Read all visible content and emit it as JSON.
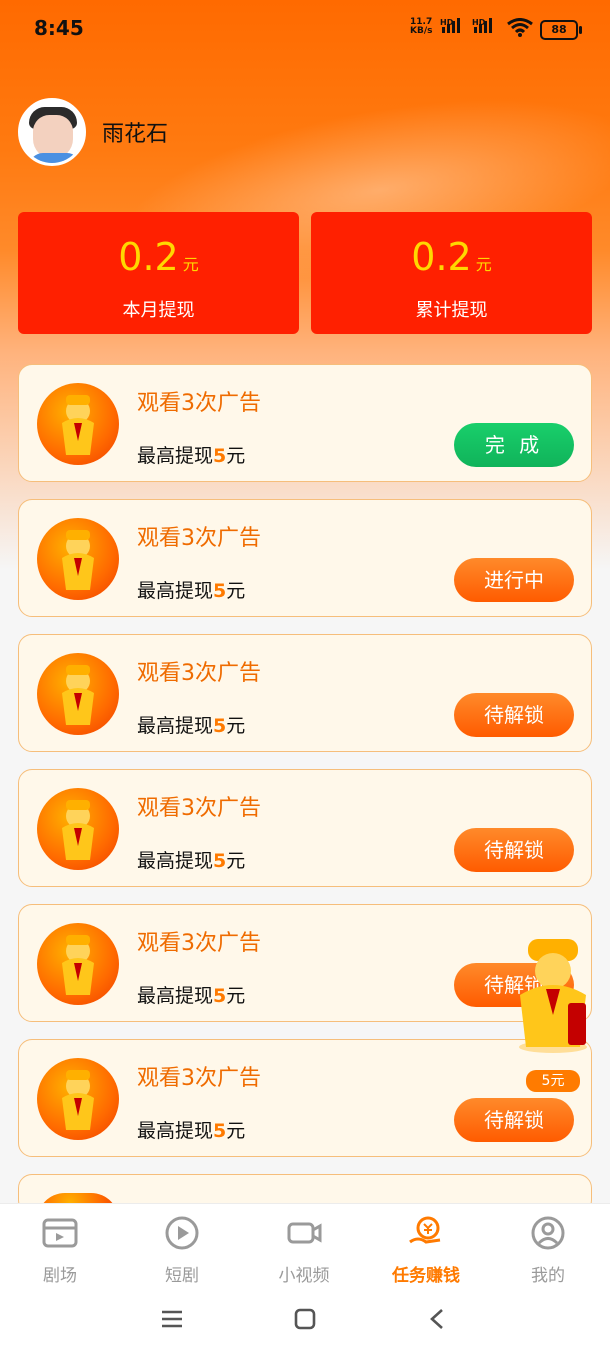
{
  "status_bar": {
    "time": "8:45",
    "network_speed_value": "11.7",
    "network_speed_unit": "KB/s",
    "hd_1": "HD",
    "hd_2": "HD",
    "battery": "88"
  },
  "profile": {
    "name": "雨花石"
  },
  "stats": [
    {
      "value": "0.2",
      "unit": "元",
      "label": "本月提现"
    },
    {
      "value": "0.2",
      "unit": "元",
      "label": "累计提现"
    }
  ],
  "tasks": [
    {
      "title": "观看3次广告",
      "desc_prefix": "最高提现",
      "desc_amount": "5",
      "desc_unit": "元",
      "button": "完 成",
      "state": "done"
    },
    {
      "title": "观看3次广告",
      "desc_prefix": "最高提现",
      "desc_amount": "5",
      "desc_unit": "元",
      "button": "进行中",
      "state": "in-progress"
    },
    {
      "title": "观看3次广告",
      "desc_prefix": "最高提现",
      "desc_amount": "5",
      "desc_unit": "元",
      "button": "待解锁",
      "state": "locked"
    },
    {
      "title": "观看3次广告",
      "desc_prefix": "最高提现",
      "desc_amount": "5",
      "desc_unit": "元",
      "button": "待解锁",
      "state": "locked"
    },
    {
      "title": "观看3次广告",
      "desc_prefix": "最高提现",
      "desc_amount": "5",
      "desc_unit": "元",
      "button": "待解锁",
      "state": "locked"
    },
    {
      "title": "观看3次广告",
      "desc_prefix": "最高提现",
      "desc_amount": "5",
      "desc_unit": "元",
      "button": "待解锁",
      "state": "locked"
    }
  ],
  "floating_reward": {
    "badge": "5元"
  },
  "bottom_nav": [
    {
      "label": "剧场",
      "icon": "theater-icon",
      "active": false
    },
    {
      "label": "短剧",
      "icon": "play-circle-icon",
      "active": false
    },
    {
      "label": "小视频",
      "icon": "video-camera-icon",
      "active": false
    },
    {
      "label": "任务赚钱",
      "icon": "money-hand-icon",
      "active": true
    },
    {
      "label": "我的",
      "icon": "profile-icon",
      "active": false
    }
  ],
  "colors": {
    "accent": "#ff7a00",
    "stat_red": "#ff2000",
    "gold": "#ffd800",
    "done_green": "#19cf6b"
  }
}
